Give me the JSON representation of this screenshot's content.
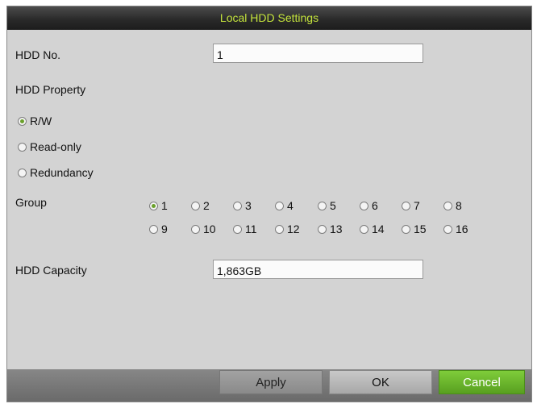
{
  "dialog": {
    "title": "Local HDD Settings"
  },
  "hdd_no": {
    "label": "HDD No.",
    "value": "1"
  },
  "hdd_property": {
    "label": "HDD Property",
    "options": [
      {
        "label": "R/W",
        "selected": true
      },
      {
        "label": "Read-only",
        "selected": false
      },
      {
        "label": "Redundancy",
        "selected": false
      }
    ]
  },
  "group": {
    "label": "Group",
    "options": [
      "1",
      "2",
      "3",
      "4",
      "5",
      "6",
      "7",
      "8",
      "9",
      "10",
      "11",
      "12",
      "13",
      "14",
      "15",
      "16"
    ],
    "selected": "1"
  },
  "hdd_capacity": {
    "label": "HDD Capacity",
    "value": "1,863GB"
  },
  "buttons": {
    "apply": "Apply",
    "ok": "OK",
    "cancel": "Cancel"
  },
  "colors": {
    "title_text": "#c4e33c",
    "accent_green": "#6aa02a",
    "cancel_button": "#58a020"
  }
}
